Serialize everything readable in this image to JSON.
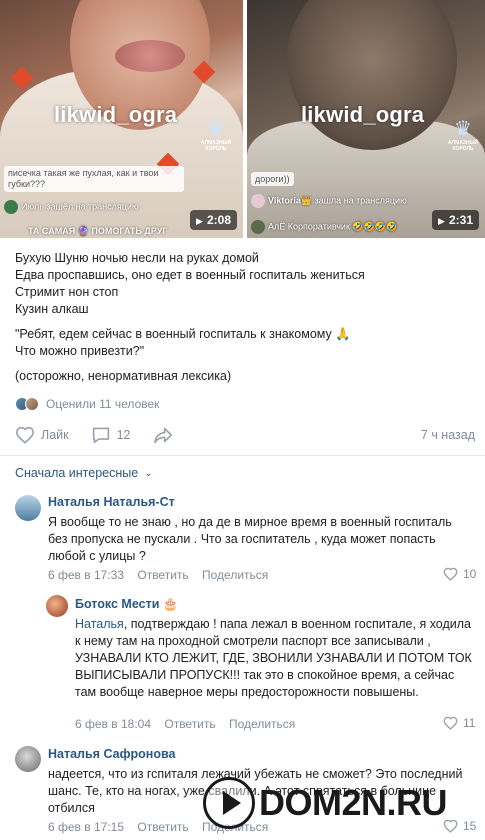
{
  "videos": [
    {
      "watermark": "likwid_ogra",
      "crown_label": "АЛМАЗНЫЙ КОРОЛЬ",
      "overlay_box": "писечка такая же пухлая, как и твои губки???",
      "overlay_join": "Июль зашёл на трансляцию",
      "overlay_bottom": "ТА САМАЯ 🔮 ПОМОГАТЬ ДРУГ",
      "duration": "2:08"
    },
    {
      "watermark": "likwid_ogra",
      "crown_label": "АЛМАЗНЫЙ КОРОЛЬ",
      "overlay_box": "дороги))",
      "overlay_join_name": "Viktoria👑",
      "overlay_join": "зашла на трансляцию",
      "overlay_bottom": "АлЁ Корпоративчик 🤣🤣🤣🤣",
      "duration": "2:31"
    }
  ],
  "post": {
    "lines": [
      "Бухую Шуню ночью несли на руках домой",
      "Едва проспавшись, оно едет в военный госпиталь жениться",
      "Стримит нон стоп",
      "Кузин алкаш"
    ],
    "quote_lines": [
      "\"Ребят, едем сейчас в военный госпиталь к знакомому 🙏",
      "Что можно привезти?\""
    ],
    "warning": "(осторожно, ненормативная лексика)"
  },
  "reactions": {
    "text": "Оценили 11 человек"
  },
  "actions": {
    "like_label": "Лайк",
    "comments_count": "12",
    "time": "7 ч назад"
  },
  "sort": {
    "label": "Сначала интересные"
  },
  "comments": [
    {
      "name": "Наталья Наталья-Ст",
      "text": "Я вообще то не знаю , но да де в мирное время в военный госпиталь без пропуска не пускали . Что за госпитатель , куда может попасть любой с улицы ?",
      "date": "6 фев в 17:33",
      "reply": "Ответить",
      "share": "Поделиться",
      "likes": "10"
    },
    {
      "name": "Ботокс Мести 🎂",
      "mention": "Наталья",
      "text": ", подтверждаю ! папа лежал в военном госпитале, я ходила к нему там на проходной смотрели паспорт все записывали , УЗНАВАЛИ КТО ЛЕЖИТ, ГДЕ, ЗВОНИЛИ УЗНАВАЛИ И ПОТОМ ТОК ВЫПИСЫВАЛИ ПРОПУСК!!! так это в спокойное время, а сейчас там вообще наверное меры предосторожности повышены.",
      "date": "6 фев в 18:04",
      "reply": "Ответить",
      "share": "Поделиться",
      "likes": "11"
    },
    {
      "name": "Наталья Сафронова",
      "text": "надеется, что из гспиталя лежачий убежать не сможет? Это последний шанс. Те, кто на ногах, уже свалили. А этот спрятаться в больнице отбился",
      "date": "6 фев в 17:15",
      "reply": "Ответить",
      "share": "Поделиться",
      "likes": "15"
    }
  ],
  "watermark_logo": "DOM2N.RU",
  "colors": {
    "link": "#2a5885",
    "meta": "#818c99"
  }
}
